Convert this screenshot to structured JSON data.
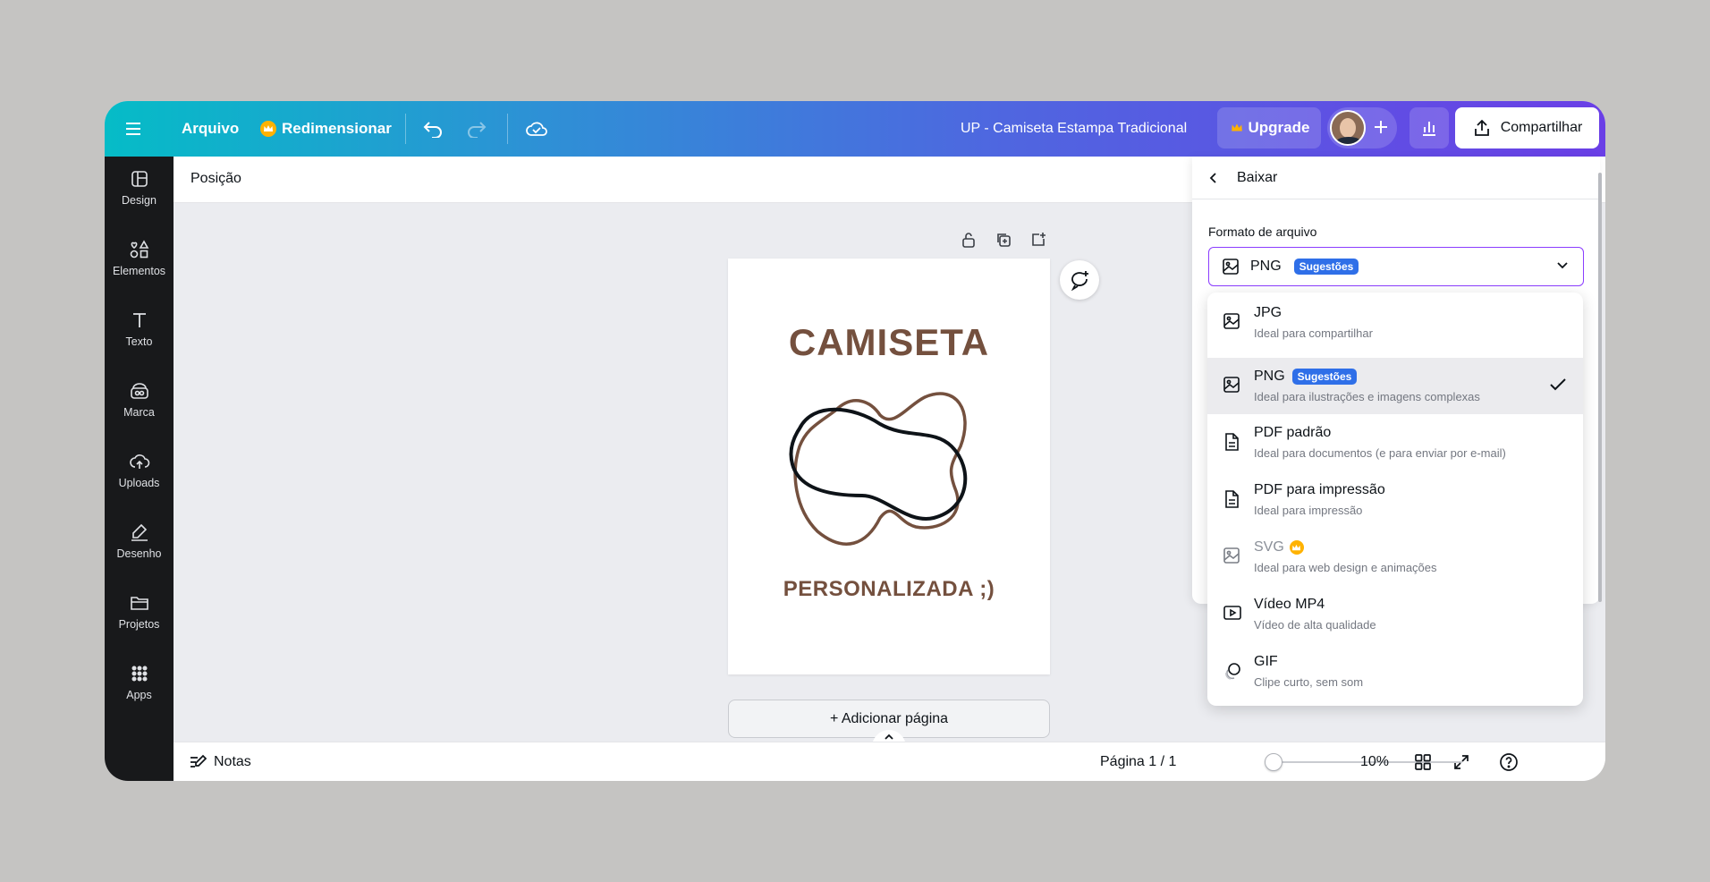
{
  "topbar": {
    "menu_icon": "hamburger-icon",
    "file_label": "Arquivo",
    "resize_label": "Redimensionar",
    "design_title": "UP - Camiseta Estampa Tradicional",
    "upgrade_label": "Upgrade",
    "share_label": "Compartilhar",
    "colors": {
      "gradient_start": "#05bcc7",
      "gradient_end": "#6a3fe6"
    }
  },
  "sidebar": {
    "items": [
      {
        "label": "Design",
        "icon": "layout-icon"
      },
      {
        "label": "Elementos",
        "icon": "shapes-icon"
      },
      {
        "label": "Texto",
        "icon": "text-icon"
      },
      {
        "label": "Marca",
        "icon": "brand-icon"
      },
      {
        "label": "Uploads",
        "icon": "cloud-upload-icon"
      },
      {
        "label": "Desenho",
        "icon": "pen-icon"
      },
      {
        "label": "Projetos",
        "icon": "folder-icon"
      },
      {
        "label": "Apps",
        "icon": "apps-grid-icon"
      }
    ]
  },
  "toolbar": {
    "position_label": "Posição"
  },
  "canvas": {
    "title_text": "CAMISETA",
    "subtitle_text": "PERSONALIZADA ;)",
    "add_page_label": "+ Adicionar página",
    "text_color": "#74503e"
  },
  "footer": {
    "notes_label": "Notas",
    "page_indicator": "Página 1 / 1",
    "zoom_value": "10%",
    "zoom_fraction": 0.0
  },
  "download_panel": {
    "title": "Baixar",
    "format_label": "Formato de arquivo",
    "selected_format": "PNG",
    "selected_badge": "Sugestões",
    "options": [
      {
        "name": "JPG",
        "desc": "Ideal para compartilhar",
        "icon": "image-icon"
      },
      {
        "name": "PNG",
        "badge": "Sugestões",
        "desc": "Ideal para ilustrações e imagens complexas",
        "icon": "image-icon",
        "selected": true
      },
      {
        "name": "PDF padrão",
        "desc": "Ideal para documentos (e para enviar por e-mail)",
        "icon": "document-icon"
      },
      {
        "name": "PDF para impressão",
        "desc": "Ideal para impressão",
        "icon": "document-icon"
      },
      {
        "name": "SVG",
        "desc": "Ideal para web design e animações",
        "icon": "image-icon",
        "premium": true
      },
      {
        "name": "Vídeo MP4",
        "desc": "Vídeo de alta qualidade",
        "icon": "video-icon"
      },
      {
        "name": "GIF",
        "desc": "Clipe curto, sem som",
        "icon": "gif-icon"
      }
    ],
    "accent_color": "#8b3dff",
    "badge_color": "#2f6fe8"
  }
}
